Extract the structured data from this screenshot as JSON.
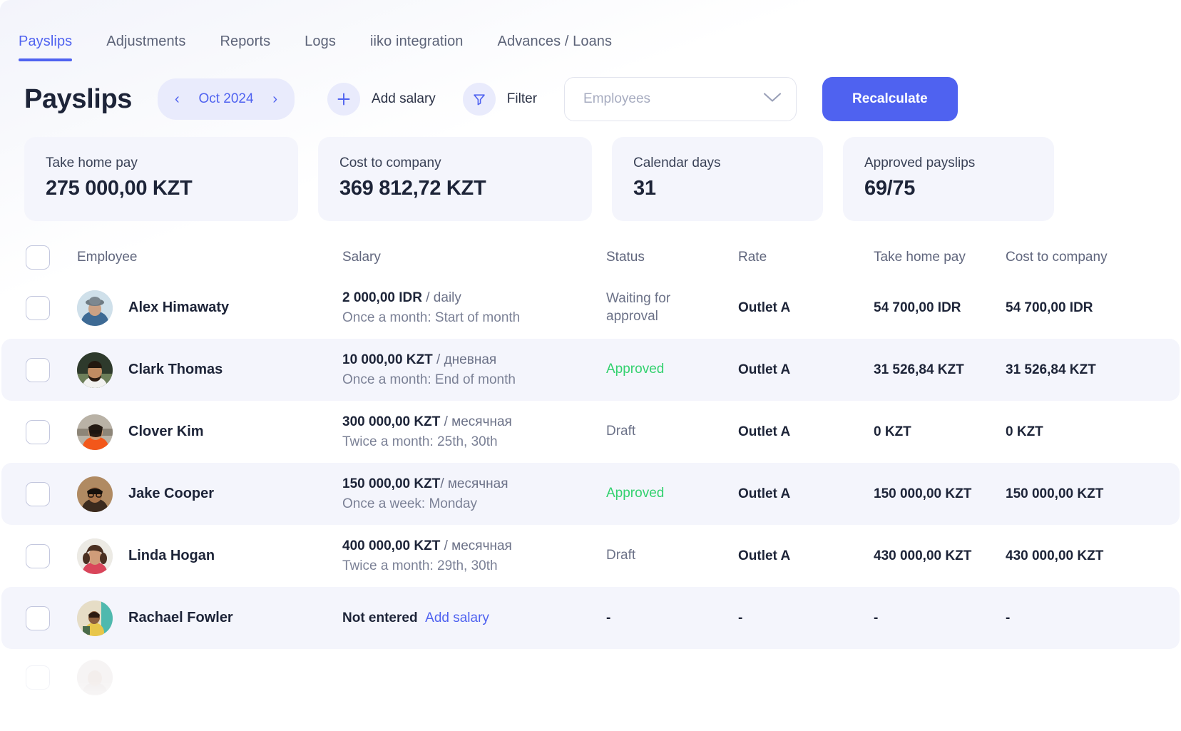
{
  "nav": {
    "tabs": [
      {
        "label": "Payslips",
        "active": true
      },
      {
        "label": "Adjustments",
        "active": false
      },
      {
        "label": "Reports",
        "active": false
      },
      {
        "label": "Logs",
        "active": false
      },
      {
        "label": "iiko integration",
        "active": false
      },
      {
        "label": "Advances / Loans",
        "active": false
      }
    ]
  },
  "toolbar": {
    "title": "Payslips",
    "month": "Oct 2024",
    "prev_arrow": "‹",
    "next_arrow": "›",
    "add_salary_label": "Add salary",
    "filter_label": "Filter",
    "employees_placeholder": "Employees",
    "recalculate_label": "Recalculate"
  },
  "stats": [
    {
      "label": "Take home pay",
      "value": "275 000,00 KZT"
    },
    {
      "label": "Cost to company",
      "value": "369 812,72 KZT"
    },
    {
      "label": "Calendar days",
      "value": "31"
    },
    {
      "label": "Approved payslips",
      "value": "69/75"
    }
  ],
  "table": {
    "columns": {
      "employee": "Employee",
      "salary": "Salary",
      "status": "Status",
      "rate": "Rate",
      "take_home_pay": "Take home pay",
      "cost_to_company": "Cost to company"
    },
    "rows": [
      {
        "name": "Alex Himawaty",
        "avatar": "avatar-hat-blue",
        "salary_amount": "2 000,00 IDR",
        "salary_unit": " / daily",
        "salary_schedule": "Once a month: Start of month",
        "status": "Waiting for\napproval",
        "status_kind": "waiting",
        "rate": "Outlet A",
        "take_home_pay": "54 700,00 IDR",
        "cost_to_company": "54 700,00 IDR"
      },
      {
        "name": "Clark Thomas",
        "avatar": "avatar-beard-dark",
        "salary_amount": "10 000,00 KZT",
        "salary_unit": " / дневная",
        "salary_schedule": "Once a month: End of month",
        "status": "Approved",
        "status_kind": "approved",
        "rate": "Outlet A",
        "take_home_pay": "31 526,84 KZT",
        "cost_to_company": "31 526,84 KZT"
      },
      {
        "name": "Clover Kim",
        "avatar": "avatar-sunglasses-orange",
        "salary_amount": "300 000,00 KZT",
        "salary_unit": " / месячная",
        "salary_schedule": "Twice a month: 25th, 30th",
        "status": "Draft",
        "status_kind": "draft",
        "rate": "Outlet A",
        "take_home_pay": "0 KZT",
        "cost_to_company": "0 KZT"
      },
      {
        "name": "Jake Cooper",
        "avatar": "avatar-glasses-brown",
        "salary_amount": "150 000,00 KZT",
        "salary_unit": "/ месячная",
        "salary_schedule": "Once a week: Monday",
        "status": "Approved",
        "status_kind": "approved",
        "rate": "Outlet A",
        "take_home_pay": "150 000,00 KZT",
        "cost_to_company": "150 000,00 KZT"
      },
      {
        "name": "Linda Hogan",
        "avatar": "avatar-curly-red",
        "salary_amount": "400 000,00 KZT",
        "salary_unit": " / месячная",
        "salary_schedule": "Twice a month: 29th, 30th",
        "status": "Draft",
        "status_kind": "draft",
        "rate": "Outlet A",
        "take_home_pay": "430 000,00 KZT",
        "cost_to_company": "430 000,00 KZT"
      },
      {
        "name": "Rachael Fowler",
        "avatar": "avatar-yellow-seated",
        "salary_amount": "Not entered",
        "salary_unit": "",
        "salary_schedule": "",
        "add_salary_link": "Add salary",
        "status": "-",
        "status_kind": "dash",
        "rate": "-",
        "take_home_pay": "-",
        "cost_to_company": "-"
      }
    ]
  },
  "colors": {
    "accent": "#4f62f0",
    "accent_soft": "#e9ebfc",
    "approved": "#33d16f",
    "text_dark": "#1d2438",
    "text_muted": "#6c7288",
    "row_alt": "#f4f5fc"
  }
}
